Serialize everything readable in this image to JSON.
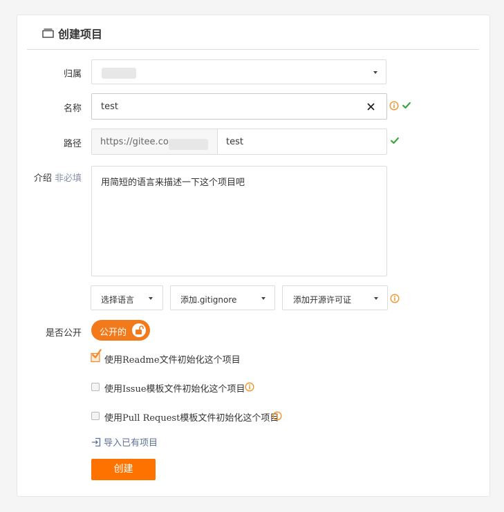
{
  "page": {
    "title": "创建项目"
  },
  "form": {
    "owner": {
      "label": "归属",
      "value": ""
    },
    "name": {
      "label": "名称",
      "value": "test"
    },
    "path": {
      "label": "路径",
      "prefix": "https://gitee.com",
      "value": "test"
    },
    "intro": {
      "label": "介绍",
      "optional_label": "非必填",
      "placeholder": "用简短的语言来描述一下这个项目吧"
    },
    "language_select": {
      "label": "选择语言"
    },
    "gitignore_select": {
      "label": "添加.gitignore"
    },
    "license_select": {
      "label": "添加开源许可证"
    },
    "visibility": {
      "label": "是否公开",
      "toggle_label": "公开的",
      "is_public": true
    },
    "options": [
      {
        "label": "使用Readme文件初始化这个项目",
        "checked": true,
        "has_info": false
      },
      {
        "label": "使用Issue模板文件初始化这个项目",
        "checked": false,
        "has_info": true
      },
      {
        "label": "使用Pull Request模板文件初始化这个项目",
        "checked": false,
        "has_info": true
      }
    ],
    "import_link": "导入已有项目",
    "submit_label": "创建"
  },
  "colors": {
    "accent": "#fe7300",
    "toggle": "#f27a1b",
    "success": "#3ba640",
    "info": "#f0952d",
    "link": "#5f7197"
  },
  "icons": {
    "title": "repository-icon",
    "clear": "close-icon",
    "info": "info-icon",
    "valid": "checkmark-icon",
    "lock": "unlock-icon",
    "import": "import-icon"
  }
}
